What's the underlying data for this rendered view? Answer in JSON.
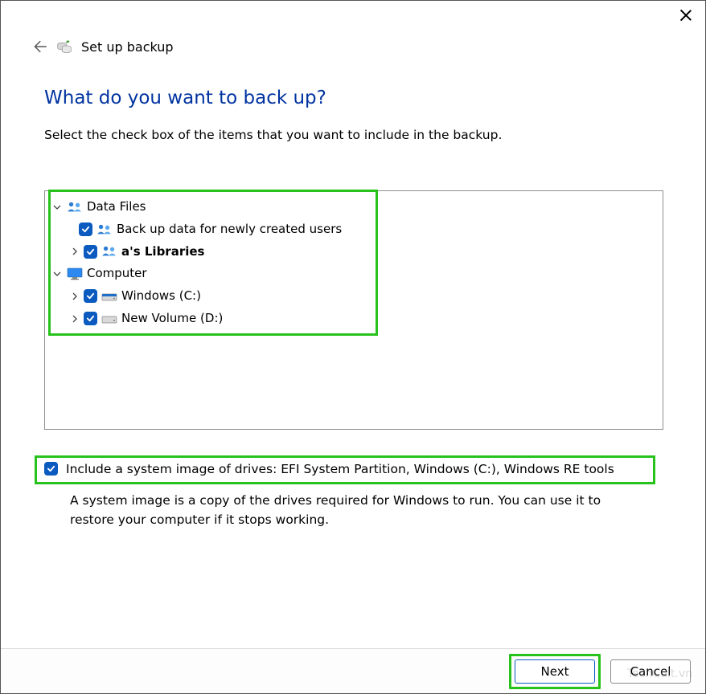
{
  "window": {
    "wizard_title": "Set up backup"
  },
  "heading": "What do you want to back up?",
  "instruction": "Select the check box of the items that you want to include in the backup.",
  "tree": {
    "data_files_label": "Data Files",
    "backup_new_users_label": "Back up data for newly created users",
    "user_libraries_label": "a's Libraries",
    "computer_label": "Computer",
    "drive_c_label": "Windows (C:)",
    "drive_d_label": "New Volume (D:)"
  },
  "system_image": {
    "label": "Include a system image of drives: EFI System Partition, Windows (C:), Windows RE tools",
    "description": "A system image is a copy of the drives required for Windows to run. You can use it to restore your computer if it stops working."
  },
  "buttons": {
    "next": "Next",
    "cancel": "Cancel"
  },
  "watermark": "TechCult.vn"
}
